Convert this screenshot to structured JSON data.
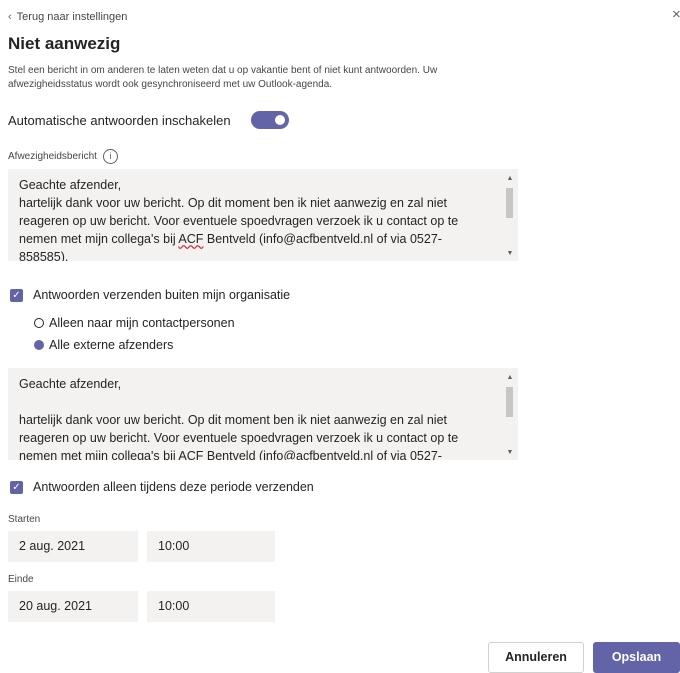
{
  "header": {
    "back_label": "Terug naar instellingen",
    "back_icon": "chevron-left-icon",
    "close_glyph": "×",
    "title": "Niet aanwezig",
    "description": "Stel een bericht in om anderen te laten weten dat u op vakantie bent of niet kunt antwoorden. Uw afwezigheidsstatus wordt ook gesynchroniseerd met uw Outlook-agenda."
  },
  "auto_reply": {
    "label": "Automatische antwoorden inschakelen",
    "enabled": true
  },
  "internal_message": {
    "label": "Afwezigheidsbericht",
    "info_glyph": "i",
    "line1": "Geachte afzender,",
    "line2": "hartelijk dank voor uw bericht. Op dit moment ben ik niet aanwezig en zal niet",
    "line3": "reageren op uw bericht. Voor eventuele spoedvragen verzoek ik u contact op te",
    "line4_pre": "nemen met mijn collega's bij ",
    "line4_squiggle": "ACF",
    "line4_post": " Bentveld (info@acfbentveld.nl of via 0527-",
    "line5": "858585)."
  },
  "external": {
    "checkbox_label": "Antwoorden verzenden buiten mijn organisatie",
    "checked": true,
    "option_contacts": "Alleen naar mijn contactpersonen",
    "option_all": "Alle externe afzenders",
    "selected": "Alle externe afzenders",
    "line1": "Geachte afzender,",
    "line2": "",
    "line3": "hartelijk dank voor uw bericht. Op dit moment ben ik niet aanwezig en zal niet",
    "line4": "reageren op uw bericht. Voor eventuele spoedvragen verzoek ik u contact op te",
    "line5": "nemen met mijn collega's bij ACF Bentveld (info@acfbentveld.nl of via 0527-"
  },
  "period": {
    "checkbox_label": "Antwoorden alleen tijdens deze periode verzenden",
    "checked": true,
    "start_label": "Starten",
    "start_date": "2 aug. 2021",
    "start_time": "10:00",
    "end_label": "Einde",
    "end_date": "20 aug. 2021",
    "end_time": "10:00"
  },
  "footer": {
    "cancel_label": "Annuleren",
    "save_label": "Opslaan"
  },
  "colors": {
    "accent": "#6264a7",
    "input_bg": "#f3f2f1",
    "text": "#252423"
  },
  "glyphs": {
    "check": "✓",
    "scroll_up": "▲",
    "scroll_down": "▼",
    "chevron_left": "‹"
  }
}
